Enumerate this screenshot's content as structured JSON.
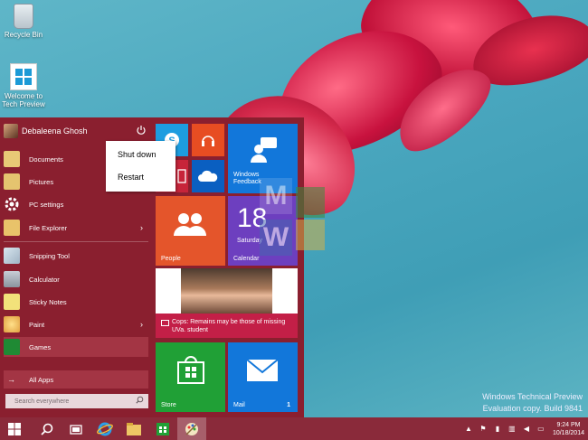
{
  "desktop": {
    "icons": [
      {
        "label": "Recycle Bin"
      },
      {
        "label": "Welcome to Tech Preview"
      }
    ],
    "watermark_letters": [
      "M",
      "W"
    ],
    "evaluation_line1": "Windows Technical Preview",
    "evaluation_line2": "Evaluation copy. Build 9841"
  },
  "start_menu": {
    "user_name": "Debaleena Ghosh",
    "power_menu": [
      "Shut down",
      "Restart"
    ],
    "places": [
      {
        "label": "Documents",
        "icon": "documents-icon"
      },
      {
        "label": "Pictures",
        "icon": "pictures-icon"
      },
      {
        "label": "PC settings",
        "icon": "settings-icon"
      },
      {
        "label": "File Explorer",
        "icon": "file-explorer-icon",
        "has_arrow": true
      }
    ],
    "apps": [
      {
        "label": "Snipping Tool",
        "icon": "snipping-tool-icon"
      },
      {
        "label": "Calculator",
        "icon": "calculator-icon"
      },
      {
        "label": "Sticky Notes",
        "icon": "sticky-notes-icon"
      },
      {
        "label": "Paint",
        "icon": "paint-icon",
        "has_arrow": true
      },
      {
        "label": "Games",
        "icon": "games-icon"
      }
    ],
    "all_apps": "All Apps",
    "search_placeholder": "Search everywhere",
    "tiles": {
      "feedback": "Windows Feedback",
      "people": "People",
      "calendar_day": "18",
      "calendar_weekday": "Saturday",
      "calendar_label": "Calendar",
      "news_headline": "Cops: Remains may be those of missing UVa. student",
      "store": "Store",
      "mail": "Mail",
      "mail_count": "1"
    }
  },
  "taskbar": {
    "time": "9:24 PM",
    "date": "10/18/2014"
  },
  "colors": {
    "accent": "#8a1f2f",
    "taskbar": "#8a2a3a"
  }
}
